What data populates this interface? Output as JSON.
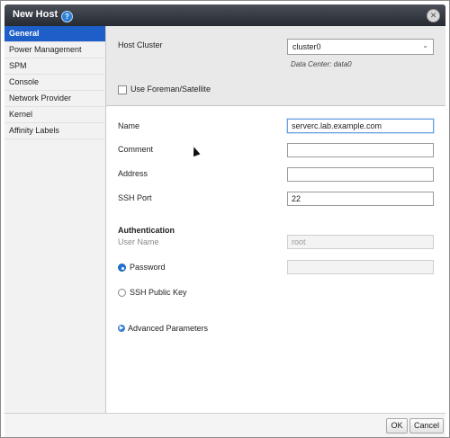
{
  "dialog": {
    "title": "New Host"
  },
  "sidebar": {
    "items": [
      {
        "label": "General",
        "active": true
      },
      {
        "label": "Power Management"
      },
      {
        "label": "SPM"
      },
      {
        "label": "Console"
      },
      {
        "label": "Network Provider"
      },
      {
        "label": "Kernel"
      },
      {
        "label": "Affinity Labels"
      }
    ]
  },
  "form": {
    "host_cluster_label": "Host Cluster",
    "host_cluster_value": "cluster0",
    "data_center_text": "Data Center: data0",
    "foreman_label": "Use Foreman/Satellite",
    "name_label": "Name",
    "name_value": "serverc.lab.example.com",
    "comment_label": "Comment",
    "comment_value": "",
    "address_label": "Address",
    "address_value": "",
    "ssh_port_label": "SSH Port",
    "ssh_port_value": "22",
    "auth_heading": "Authentication",
    "username_label": "User Name",
    "username_value": "root",
    "password_label": "Password",
    "password_value": "",
    "ssh_key_label": "SSH Public Key",
    "advanced_label": "Advanced Parameters"
  },
  "footer": {
    "ok_label": "OK",
    "cancel_label": "Cancel"
  },
  "colors": {
    "accent": "#1e5ec9",
    "titlebar": "#2f333a"
  }
}
